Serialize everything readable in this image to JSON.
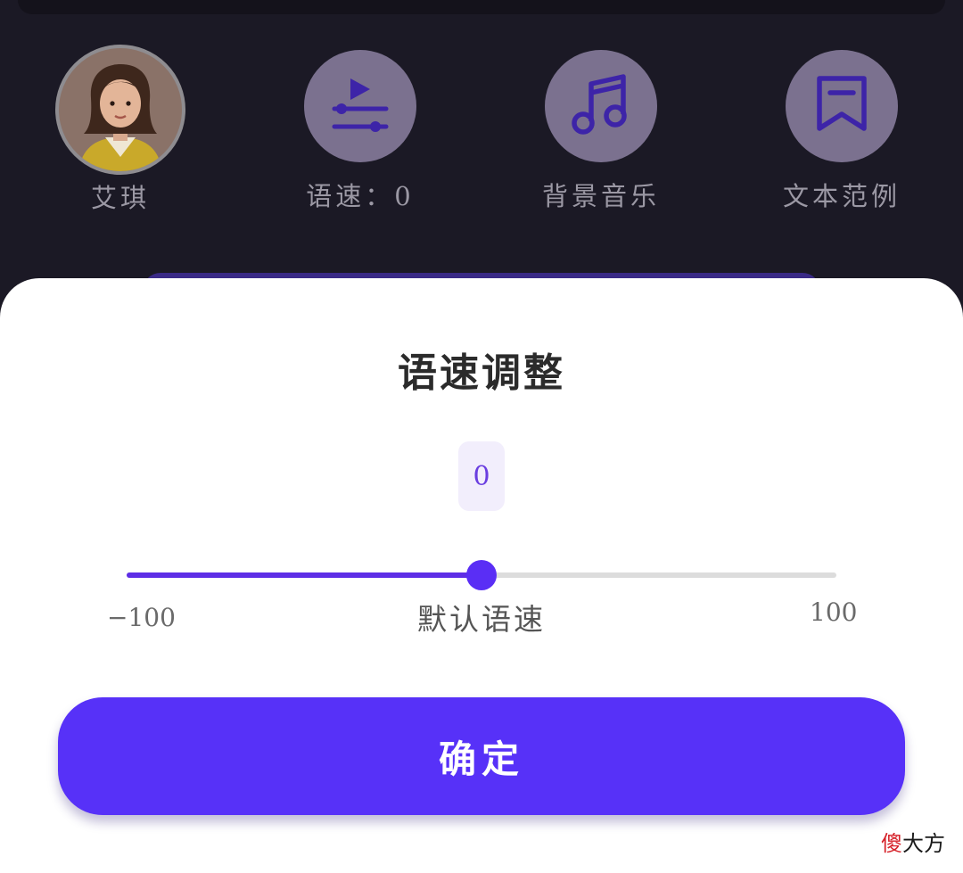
{
  "toolbar": {
    "items": [
      {
        "label": "艾琪",
        "icon": "avatar"
      },
      {
        "label": "语速：0",
        "icon": "speed-slider-icon"
      },
      {
        "label": "背景音乐",
        "icon": "music-note-icon"
      },
      {
        "label": "文本范例",
        "icon": "bookmark-icon"
      }
    ]
  },
  "sheet": {
    "title": "语速调整",
    "value": "0",
    "slider": {
      "min": -100,
      "max": 100,
      "value": 0,
      "min_label": "−100",
      "max_label": "100",
      "default_label": "默认语速"
    },
    "confirm_label": "确定"
  },
  "watermark": {
    "first_char": "傻",
    "rest": "大方"
  },
  "colors": {
    "accent": "#5731f8",
    "track": "#dcdcdc",
    "value_bg": "#f2eefc",
    "dim_bg": "#1b1925"
  }
}
